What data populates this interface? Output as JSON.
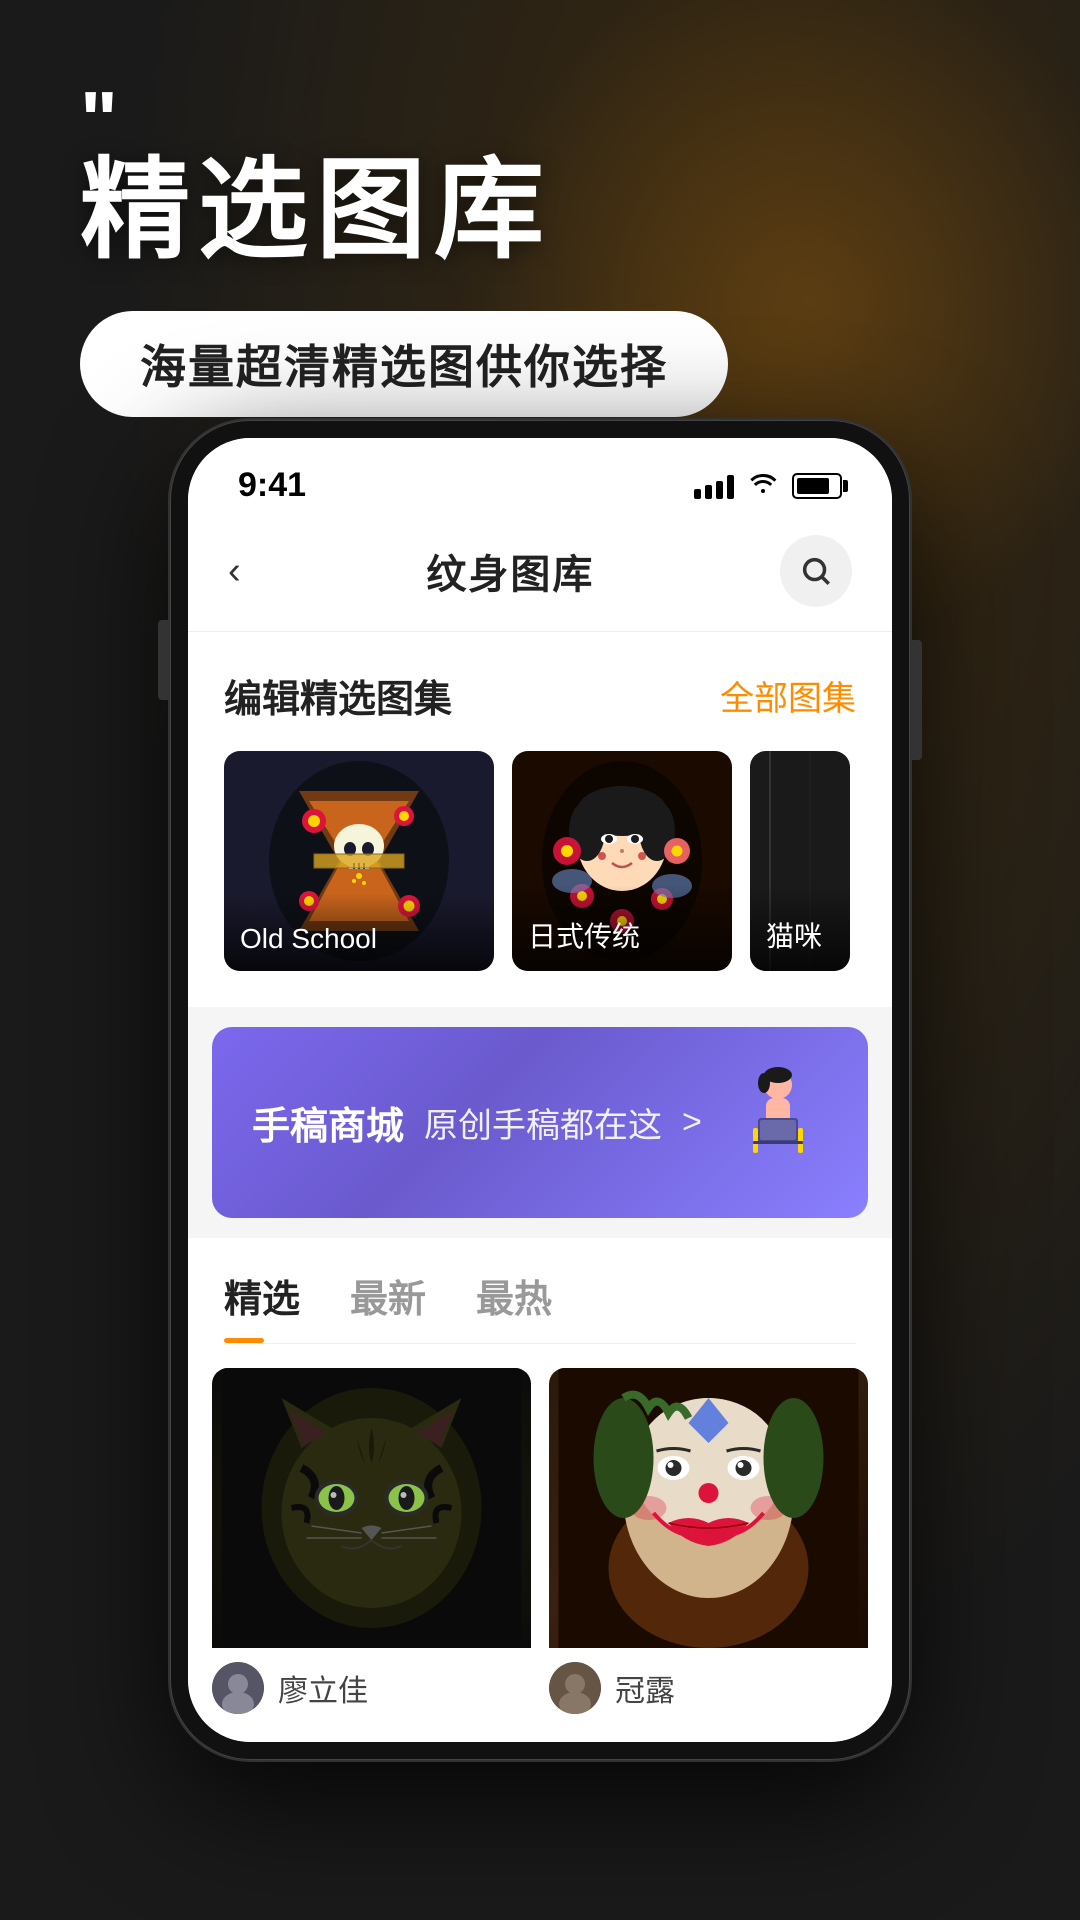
{
  "background": {
    "color": "#1a1a1a"
  },
  "hero": {
    "quote_marks": "\"",
    "title": "精选图库",
    "subtitle": "海量超清精选图供你选择"
  },
  "phone": {
    "status_bar": {
      "time": "9:41"
    },
    "nav": {
      "title": "纹身图库",
      "back_icon": "chevron-left",
      "search_icon": "search"
    },
    "editors_picks": {
      "section_title": "编辑精选图集",
      "section_more": "全部图集",
      "items": [
        {
          "id": 1,
          "label": "Old School",
          "size": "large"
        },
        {
          "id": 2,
          "label": "日式传统",
          "size": "medium"
        },
        {
          "id": 3,
          "label": "猫咪",
          "size": "medium"
        }
      ]
    },
    "banner": {
      "title": "手稿商城",
      "subtitle": "原创手稿都在这",
      "arrow": ">",
      "illustration": "🧑‍💻"
    },
    "tabs": [
      {
        "id": "featured",
        "label": "精选",
        "active": true
      },
      {
        "id": "latest",
        "label": "最新",
        "active": false
      },
      {
        "id": "hottest",
        "label": "最热",
        "active": false
      }
    ],
    "grid_items": [
      {
        "id": 1,
        "type": "tiger",
        "emoji": "🐯",
        "user_name": "廖立佳"
      },
      {
        "id": 2,
        "type": "clown",
        "emoji": "🤡",
        "user_name": "冠露"
      }
    ]
  }
}
